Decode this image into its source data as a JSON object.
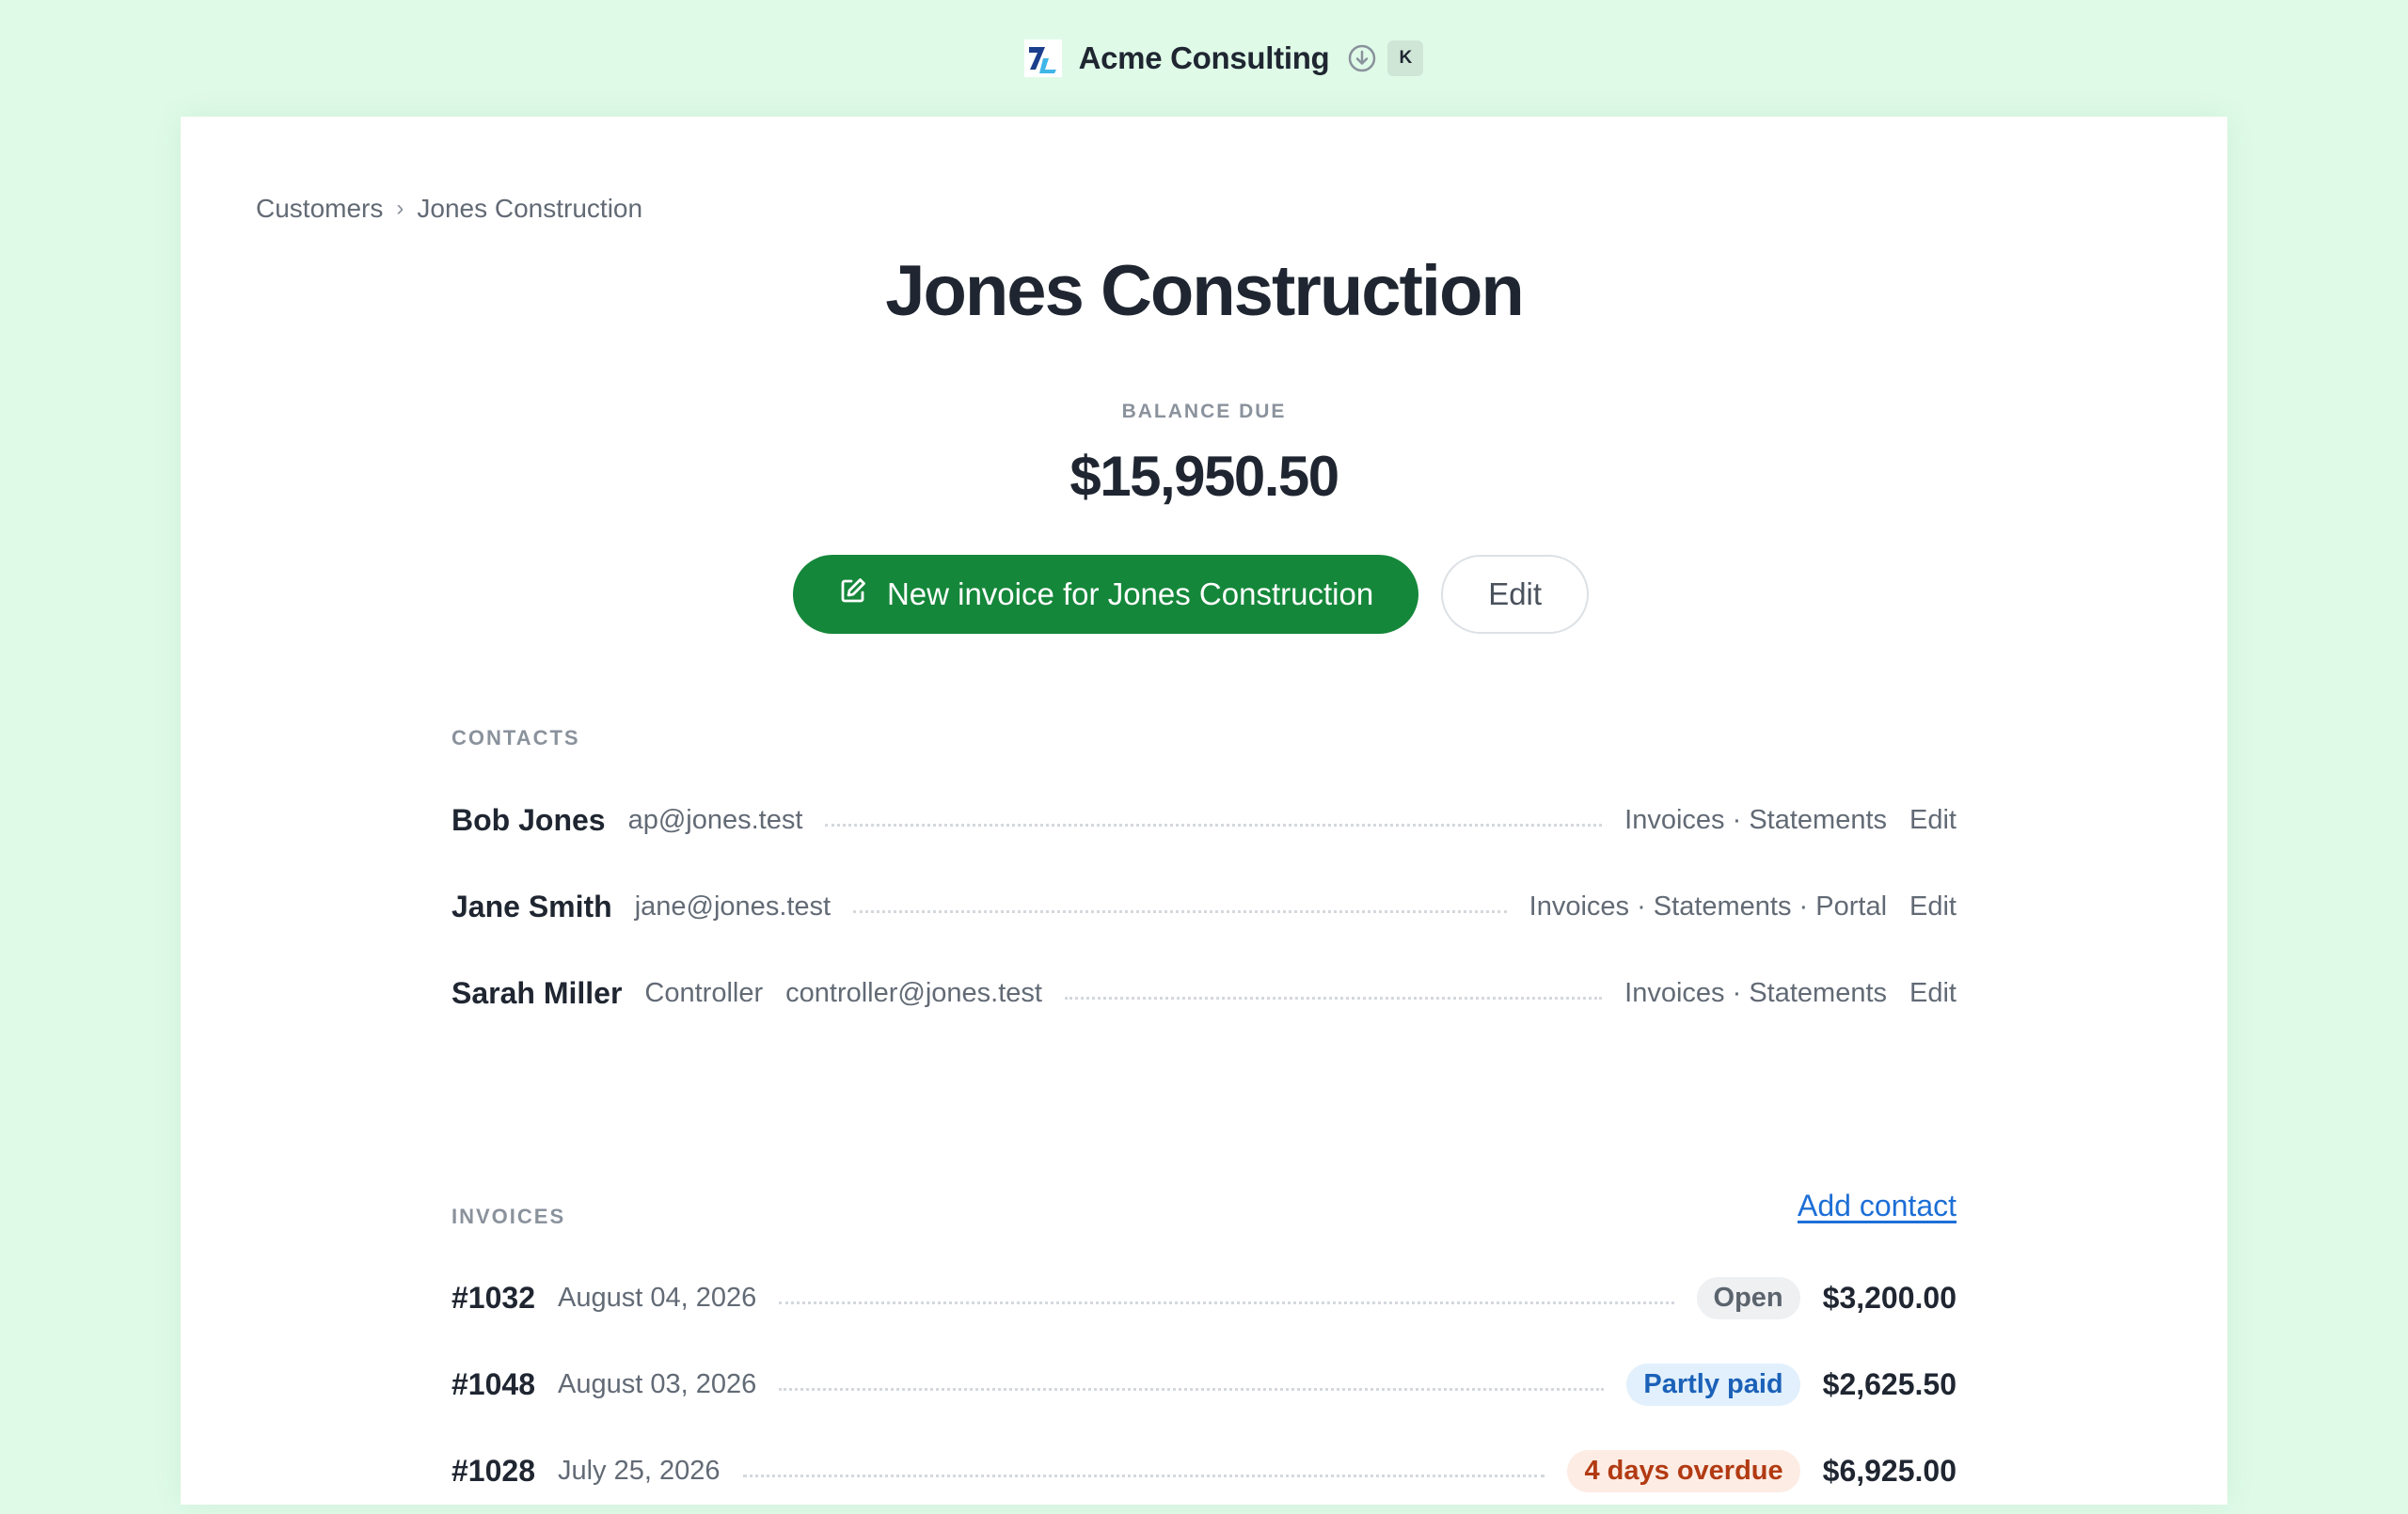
{
  "header": {
    "org_name": "Acme Consulting",
    "logo_icon": "acme-logo",
    "download_icon": "download-circle-icon",
    "avatar_initial": "K"
  },
  "breadcrumb": {
    "parent": "Customers",
    "separator": "›",
    "current": "Jones Construction"
  },
  "customer": {
    "title": "Jones Construction",
    "balance_label": "BALANCE DUE",
    "balance_value": "$15,950.50"
  },
  "actions": {
    "new_invoice_label": "New invoice for Jones Construction",
    "new_invoice_icon": "edit-square-icon",
    "edit_label": "Edit"
  },
  "contacts": {
    "label": "CONTACTS",
    "items": [
      {
        "name": "Bob Jones",
        "role": "",
        "email": "ap@jones.test",
        "prefs": "Invoices · Statements",
        "edit": "Edit"
      },
      {
        "name": "Jane Smith",
        "role": "",
        "email": "jane@jones.test",
        "prefs": "Invoices · Statements · Portal",
        "edit": "Edit"
      },
      {
        "name": "Sarah Miller",
        "role": "Controller",
        "email": "controller@jones.test",
        "prefs": "Invoices · Statements",
        "edit": "Edit"
      }
    ],
    "add_label": "Add contact"
  },
  "invoices": {
    "label": "INVOICES",
    "items": [
      {
        "number": "#1032",
        "date": "August 04, 2026",
        "status": "Open",
        "amount": "$3,200.00"
      },
      {
        "number": "#1048",
        "date": "August 03, 2026",
        "status": "Partly paid",
        "amount": "$2,625.50"
      },
      {
        "number": "#1028",
        "date": "July 25, 2026",
        "status": "4 days overdue",
        "amount": "$6,925.00"
      }
    ]
  },
  "colors": {
    "page_background": "#dffbe8",
    "primary_button": "#15873a",
    "link": "#1d6fd6",
    "status_open_bg": "#eef0f2",
    "status_open_text": "#5b636d",
    "status_partly_bg": "#e1f0fc",
    "status_partly_text": "#1b61b8",
    "status_overdue_bg": "#fdece4",
    "status_overdue_text": "#b23a12"
  }
}
